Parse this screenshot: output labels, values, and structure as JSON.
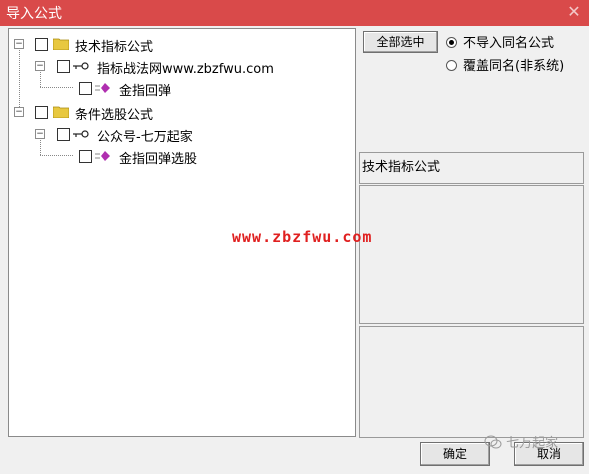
{
  "window": {
    "title": "导入公式",
    "close_glyph": "✕"
  },
  "tree": {
    "nodes": [
      {
        "label": "技术指标公式",
        "kind": "folder"
      },
      {
        "label": "指标战法网www.zbzfwu.com",
        "kind": "key"
      },
      {
        "label": "金指回弹",
        "kind": "formula"
      },
      {
        "label": "条件选股公式",
        "kind": "folder"
      },
      {
        "label": "公众号-七万起家",
        "kind": "key"
      },
      {
        "label": "金指回弹选股",
        "kind": "formula"
      }
    ]
  },
  "options": {
    "select_all_label": "全部选中",
    "radio_skip_label": "不导入同名公式",
    "radio_overwrite_label": "覆盖同名(非系统)",
    "selected": "radio_skip"
  },
  "info": {
    "category_label": "技术指标公式"
  },
  "footer": {
    "ok_label": "确定",
    "cancel_label": "取消"
  },
  "watermarks": {
    "center": "www.zbzfwu.com",
    "corner": "七万起家"
  },
  "colors": {
    "titlebar": "#d94a4a",
    "folder": "#e8c840",
    "formula_icon": "#b02fb0",
    "watermark": "#e02020"
  }
}
